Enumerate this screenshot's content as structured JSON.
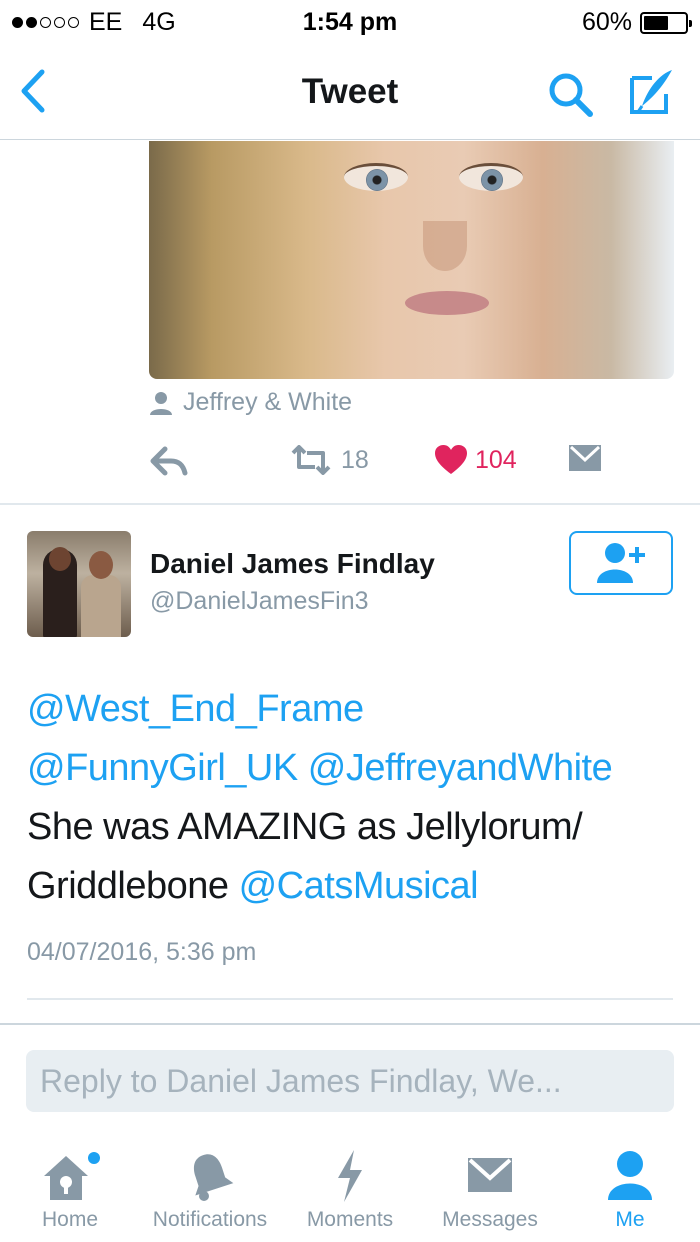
{
  "status_bar": {
    "carrier": "EE",
    "network": "4G",
    "time": "1:54 pm",
    "battery": "60%",
    "battery_level": 0.6,
    "signal_bars_filled": 2,
    "signal_bars_total": 5
  },
  "nav": {
    "back_icon": "chevron-left-icon",
    "title": "Tweet",
    "search_icon": "search-icon",
    "compose_icon": "compose-icon"
  },
  "previous_tweet": {
    "image_credit_icon": "person-icon",
    "image_credit": "Jeffrey & White",
    "retweet_count": "18",
    "like_count": "104"
  },
  "tweet": {
    "author_name": "Daniel James Findlay",
    "author_handle": "@DanielJamesFin3",
    "follow_icon": "add-user-icon",
    "mention_1": "@West_End_Frame",
    "mention_2": "@FunnyGirl_UK",
    "mention_3": "@JeffreyandWhite",
    "text_1": "She was AMAZING as Jellylorum/",
    "text_2": "Griddlebone",
    "mention_4": "@CatsMusical",
    "timestamp": "04/07/2016, 5:36 pm"
  },
  "reply": {
    "placeholder": "Reply to Daniel James Findlay, We..."
  },
  "tabbar": {
    "tabs": [
      {
        "label": "Home",
        "icon": "home-icon"
      },
      {
        "label": "Notifications",
        "icon": "bell-icon"
      },
      {
        "label": "Moments",
        "icon": "lightning-icon"
      },
      {
        "label": "Messages",
        "icon": "envelope-icon"
      },
      {
        "label": "Me",
        "icon": "person-icon"
      }
    ],
    "active_tab": "Me"
  },
  "colors": {
    "accent": "#1da1f2",
    "like": "#e0245e",
    "muted": "#8899a6"
  }
}
